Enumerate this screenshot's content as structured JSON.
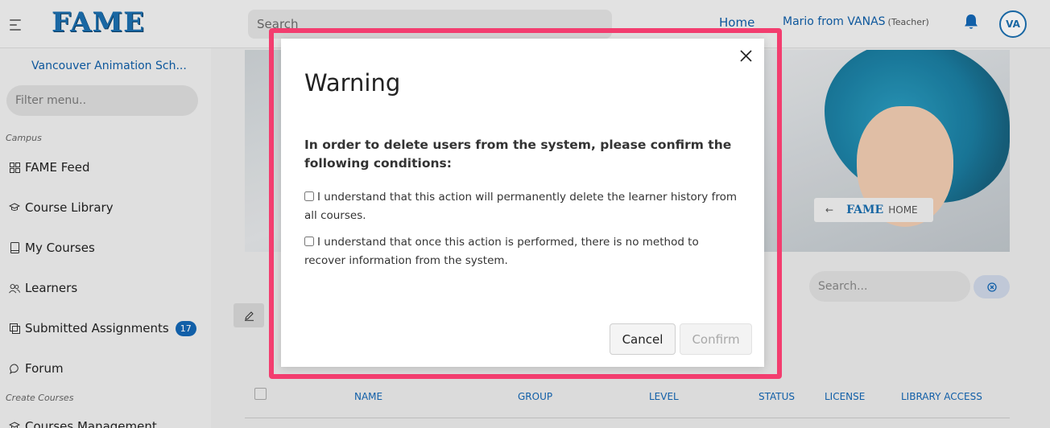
{
  "app": {
    "logo_text": "FAME",
    "search_placeholder": "Search",
    "nav_home": "Home",
    "user_name": "Mario from VANAS",
    "user_role": "(Teacher)",
    "avatar_initials": "VA"
  },
  "sidebar": {
    "school": "Vancouver Animation Sch...",
    "filter_placeholder": "Filter menu..",
    "section_campus": "Campus",
    "section_create": "Create Courses",
    "items": [
      {
        "label": "FAME Feed",
        "icon": "grid-icon"
      },
      {
        "label": "Course Library",
        "icon": "graduation-cap-icon"
      },
      {
        "label": "My Courses",
        "icon": "book-icon"
      },
      {
        "label": "Learners",
        "icon": "users-icon"
      },
      {
        "label": "Submitted Assignments",
        "icon": "assignment-icon",
        "badge": "17"
      },
      {
        "label": "Forum",
        "icon": "chat-icon"
      },
      {
        "label": "Courses Management",
        "icon": "graduation-cap-icon"
      }
    ]
  },
  "hero": {
    "button_text": "HOME",
    "button_logo": "FAME"
  },
  "table": {
    "search_placeholder": "Search...",
    "columns": [
      "NAME",
      "GROUP",
      "LEVEL",
      "STATUS",
      "LICENSE",
      "LIBRARY ACCESS"
    ]
  },
  "modal": {
    "title": "Warning",
    "intro": "In order to delete users from the system, please confirm the following conditions:",
    "conditions": [
      "I understand that this action will permanently delete the learner history from all courses.",
      "I understand that once this action is performed, there is no method to recover information from the system."
    ],
    "cancel_label": "Cancel",
    "confirm_label": "Confirm"
  },
  "colors": {
    "brand": "#1b6fb0",
    "link": "#0e5ea8",
    "highlight": "#f33d6f",
    "badge": "#1367b5"
  }
}
